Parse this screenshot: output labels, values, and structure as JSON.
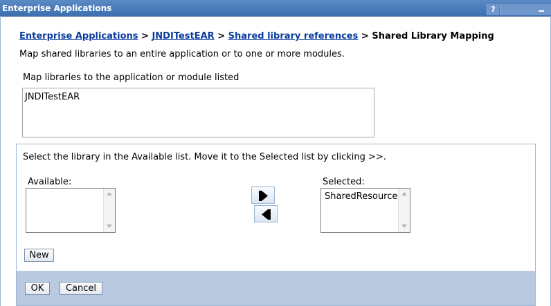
{
  "window": {
    "title": "Enterprise Applications",
    "help_label": "?"
  },
  "breadcrumb": {
    "items": [
      {
        "label": "Enterprise Applications",
        "link": true
      },
      {
        "label": "JNDITestEAR",
        "link": true
      },
      {
        "label": "Shared library references",
        "link": true
      },
      {
        "label": "Shared Library Mapping",
        "link": false
      }
    ],
    "separator": ">"
  },
  "description": "Map shared libraries to an entire application or to one or more modules.",
  "mapping": {
    "label": "Map libraries to the application or module listed",
    "modules": [
      "JNDITestEAR"
    ]
  },
  "library_panel": {
    "instruction": "Select the library in the Available list. Move it to the Selected list by clicking >>.",
    "available_label": "Available:",
    "available_items": [],
    "selected_label": "Selected:",
    "selected_items": [
      "SharedResources"
    ],
    "add_icon": "arrow-right-icon",
    "remove_icon": "arrow-left-icon",
    "new_label": "New"
  },
  "footer": {
    "ok_label": "OK",
    "cancel_label": "Cancel"
  },
  "colors": {
    "title_bar": "#4a7ebb",
    "link": "#0a3c9e",
    "footer_bg": "#b8c9e0"
  }
}
